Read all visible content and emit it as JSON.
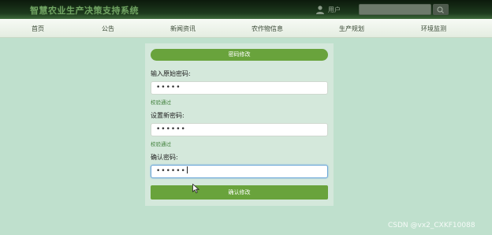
{
  "header": {
    "site_title": "智慧农业生产决策支持系统",
    "login_text": "用户",
    "search_placeholder": ""
  },
  "nav": {
    "items": [
      {
        "label": "首页"
      },
      {
        "label": "公告"
      },
      {
        "label": "新闻资讯"
      },
      {
        "label": "农作物信息"
      },
      {
        "label": "生产规划"
      },
      {
        "label": "环境监测"
      }
    ]
  },
  "form": {
    "title": "密码修改",
    "fields": [
      {
        "label": "输入原始密码:",
        "value": "•••••",
        "validation": "校验通过"
      },
      {
        "label": "设置新密码:",
        "value": "••••••",
        "validation": "校验通过"
      },
      {
        "label": "确认密码:",
        "value": "••••••",
        "validation": ""
      }
    ],
    "submit_label": "确认修改"
  },
  "watermark": "CSDN @vx2_CXKF10088",
  "colors": {
    "background": "#bfe0cd",
    "accent_green": "#69a33c",
    "header_dark": "#0c1a0c"
  }
}
